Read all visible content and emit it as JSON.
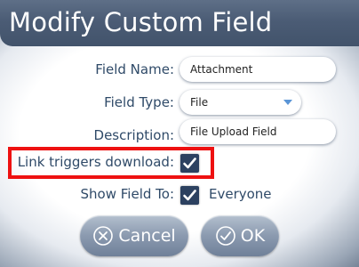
{
  "dialog": {
    "title": "Modify Custom Field"
  },
  "form": {
    "field_name": {
      "label": "Field Name:",
      "value": "Attachment"
    },
    "field_type": {
      "label": "Field Type:",
      "value": "File"
    },
    "description": {
      "label": "Description:",
      "value": "File Upload Field"
    },
    "link_triggers_download": {
      "label": "Link triggers download:",
      "checked": true
    },
    "show_field_to": {
      "label": "Show Field To:",
      "checked": true,
      "option_label": "Everyone"
    }
  },
  "buttons": {
    "cancel": "Cancel",
    "ok": "OK"
  },
  "colors": {
    "titlebar": "#4b5c75",
    "label_text": "#2f4a68",
    "checkbox": "#2c4160",
    "highlight": "#ee1111"
  },
  "icons": {
    "cancel": "circle-x-icon",
    "ok": "circle-check-icon",
    "select": "chevron-down-icon",
    "checkbox": "checkmark-icon"
  }
}
